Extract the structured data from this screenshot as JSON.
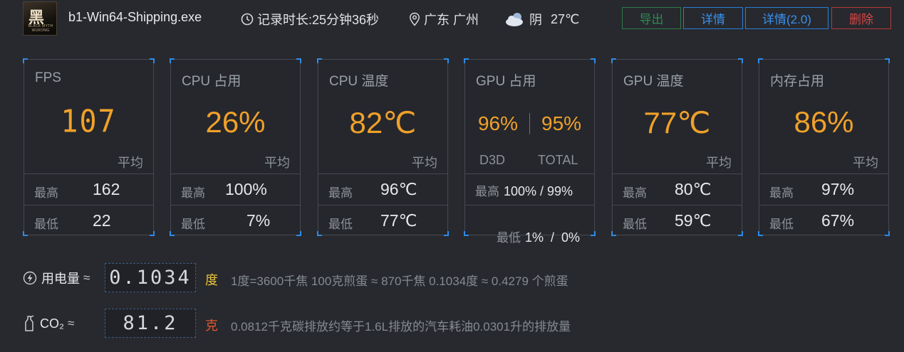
{
  "header": {
    "logo_glyph": "黑",
    "logo_sub": "BLACK MYTH WUKONG",
    "app_name": "b1-Win64-Shipping.exe",
    "duration": "记录时长:25分钟36秒",
    "location": "广东 广州",
    "weather": "阴",
    "temperature": "27℃",
    "buttons": {
      "export": "导出",
      "detail": "详情",
      "detail2": "详情(2.0)",
      "delete": "删除"
    }
  },
  "labels": {
    "avg": "平均",
    "max": "最高",
    "min": "最低"
  },
  "cards": {
    "fps": {
      "title": "FPS",
      "avg": "107",
      "max": "162",
      "min": "22"
    },
    "cpu_usage": {
      "title": "CPU 占用",
      "avg": "26%",
      "max": "100%",
      "min": "7%"
    },
    "cpu_temp": {
      "title": "CPU 温度",
      "avg": "82℃",
      "max": "96℃",
      "min": "77℃"
    },
    "gpu_usage": {
      "title": "GPU 占用",
      "d3d": "96%",
      "total": "95%",
      "d3d_label": "D3D",
      "total_label": "TOTAL",
      "max": "100% / 99%",
      "min": "1%  /  0%"
    },
    "gpu_temp": {
      "title": "GPU 温度",
      "avg": "77℃",
      "max": "80℃",
      "min": "59℃"
    },
    "mem_usage": {
      "title": "内存占用",
      "avg": "86%",
      "max": "97%",
      "min": "67%"
    }
  },
  "power": {
    "label": "用电量",
    "approx": "≈",
    "value": "0.1034",
    "unit": "度",
    "info": "1度=3600千焦    100克煎蛋 ≈ 870千焦    0.1034度 ≈ 0.4279 个煎蛋"
  },
  "co2": {
    "label": "CO₂",
    "approx": "≈",
    "value": "81.2",
    "unit": "克",
    "info": "0.0812千克碳排放约等于1.6L排放的汽车耗油0.0301升的排放量"
  },
  "colors": {
    "accent": "#f0a12a",
    "export": "#2e8a52",
    "detail": "#3a91f0",
    "delete": "#d84545",
    "power_unit": "#e8c23a",
    "co2_unit": "#e2582e"
  },
  "icons": [
    "clock-icon",
    "location-icon",
    "cloud-icon",
    "lightning-icon",
    "co2-bottle-icon"
  ]
}
